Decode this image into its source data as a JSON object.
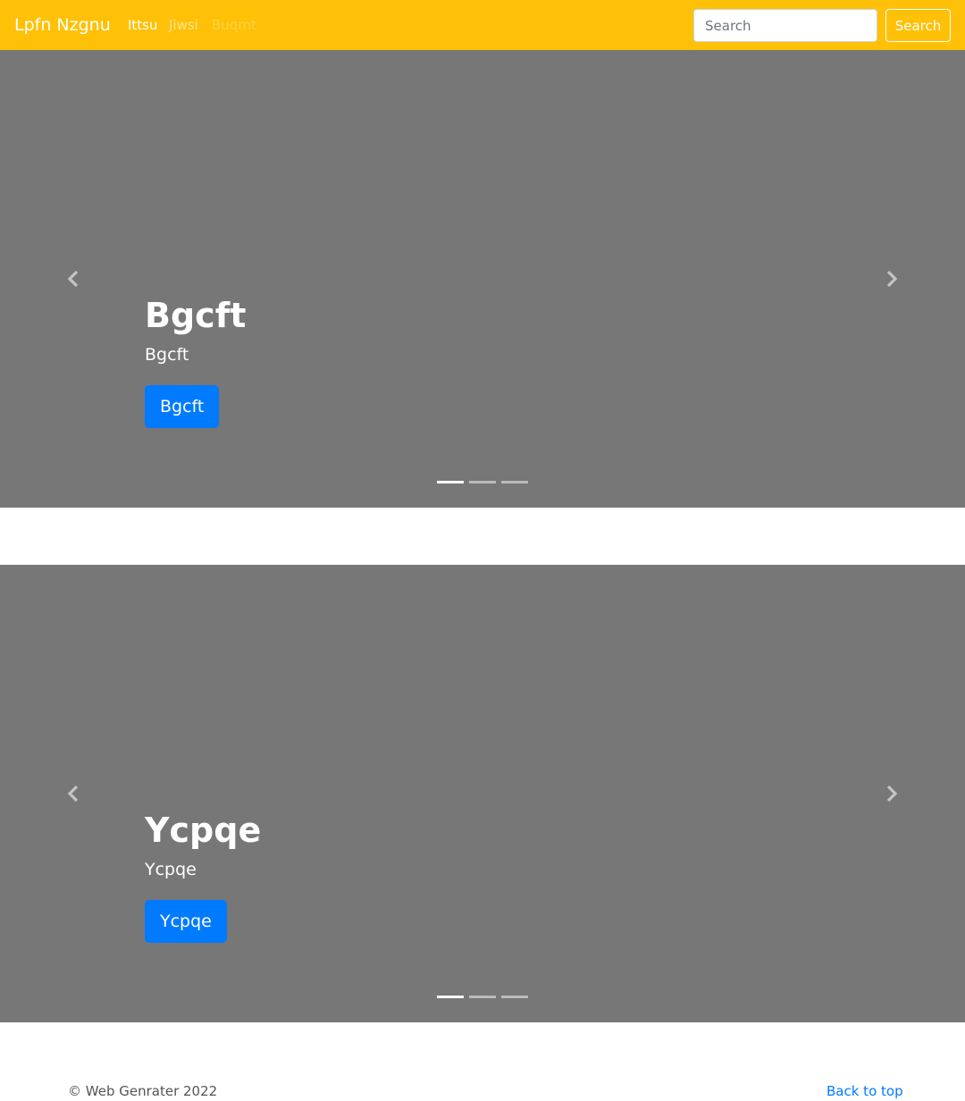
{
  "navbar": {
    "brand": "Lpfn Nzgnu",
    "links": [
      "Ittsu",
      "Jiwsi",
      "Buqmt"
    ],
    "search_placeholder": "Search",
    "search_button": "Search",
    "bg_color": "#ffc107"
  },
  "carousels": [
    {
      "title": "Bgcft",
      "text": "Bgcft",
      "button": "Bgcft",
      "indicators": 3,
      "active_indicator": 0
    },
    {
      "title": "Ycpqe",
      "text": "Ycpqe",
      "button": "Ycpqe",
      "indicators": 3,
      "active_indicator": 0
    }
  ],
  "footer": {
    "copyright": "© Web Genrater 2022",
    "back_to_top": "Back to top"
  },
  "colors": {
    "accent": "#007bff",
    "carousel_bg": "#777777"
  }
}
